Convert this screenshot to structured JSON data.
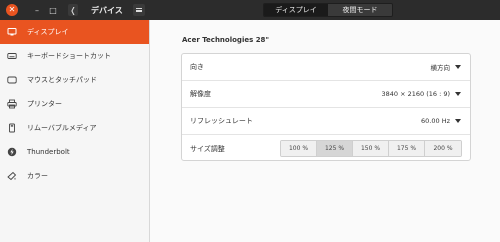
{
  "header": {
    "title": "デバイス",
    "close_glyph": "✕",
    "minimize_glyph": "–",
    "maximize_glyph": "□",
    "back_glyph": "❬",
    "tabs": [
      {
        "label": "ディスプレイ",
        "active": true
      },
      {
        "label": "夜間モード",
        "active": false
      }
    ]
  },
  "sidebar": {
    "items": [
      {
        "label": "ディスプレイ",
        "icon": "display-icon",
        "active": true
      },
      {
        "label": "キーボードショートカット",
        "icon": "keyboard-icon",
        "active": false
      },
      {
        "label": "マウスとタッチパッド",
        "icon": "mouse-icon",
        "active": false
      },
      {
        "label": "プリンター",
        "icon": "printer-icon",
        "active": false
      },
      {
        "label": "リムーバブルメディア",
        "icon": "removable-media-icon",
        "active": false
      },
      {
        "label": "Thunderbolt",
        "icon": "thunderbolt-icon",
        "active": false
      },
      {
        "label": "カラー",
        "icon": "color-icon",
        "active": false
      }
    ]
  },
  "main": {
    "monitor_name": "Acer Technologies 28\"",
    "orientation": {
      "label": "向き",
      "value": "横方向"
    },
    "resolution": {
      "label": "解像度",
      "value": "3840 × 2160 (16 : 9)"
    },
    "refresh_rate": {
      "label": "リフレッシュレート",
      "value": "60.00 Hz"
    },
    "scale": {
      "label": "サイズ調整",
      "options": [
        "100 %",
        "125 %",
        "150 %",
        "175 %",
        "200 %"
      ],
      "selected": "125 %"
    }
  },
  "colors": {
    "accent": "#e95420",
    "headerbar": "#2c2c2c"
  }
}
